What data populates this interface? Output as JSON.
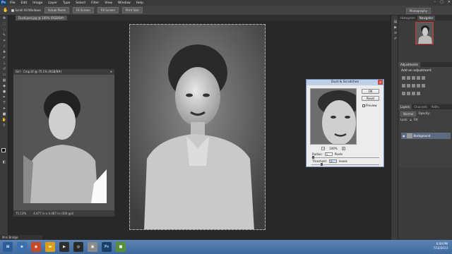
{
  "app": {
    "logo": "Ps"
  },
  "menu": [
    "File",
    "Edit",
    "Image",
    "Layer",
    "Type",
    "Select",
    "Filter",
    "View",
    "Window",
    "Help"
  ],
  "window_controls": [
    "–",
    "▢",
    "✕"
  ],
  "options_bar": {
    "scroll_all_windows": "Scroll All Windows",
    "actual_pixels": "Actual Pixels",
    "fit_screen": "Fit Screen",
    "fill_screen": "Fill Screen",
    "print_size": "Print Size",
    "workspace": "Photography"
  },
  "document_tab": "DustLpad.jpg @ 100% (RGB/8#)",
  "floating_window": {
    "title": "Girl - Crop.tif @ 75.1% (RGB/8#)",
    "zoom": "75.13%",
    "doc_size": "4.477 in x 4.487 in (300 ppi)"
  },
  "dust_dialog": {
    "title": "Dust & Scratches",
    "ok": "OK",
    "reset": "Reset",
    "preview_label": "Preview",
    "zoom": "100%",
    "radius_label": "Radius:",
    "radius_value": "1",
    "radius_unit": "Pixels",
    "threshold_label": "Threshold:",
    "threshold_value": "0",
    "threshold_unit": "levels"
  },
  "right_panel": {
    "top_tabs": [
      "Histogram",
      "Navigator"
    ],
    "adjustments_tab": "Adjustments",
    "adjustments_heading": "Add an adjustment",
    "layers_tabs": [
      "Layers",
      "Channels",
      "Paths"
    ],
    "blend_mode": "Normal",
    "opacity_label": "Opacity:",
    "fill_label": "Fill:",
    "lock_label": "Lock:",
    "layer_name": "Background"
  },
  "mini_bridge": "Mini Bridge",
  "clock": {
    "time": "6:09 PM",
    "date": "7/10/2013"
  },
  "colors": {
    "taskbar": "#4a76aa",
    "canvas_bg": "#282828",
    "selection": "#6b89b6"
  }
}
